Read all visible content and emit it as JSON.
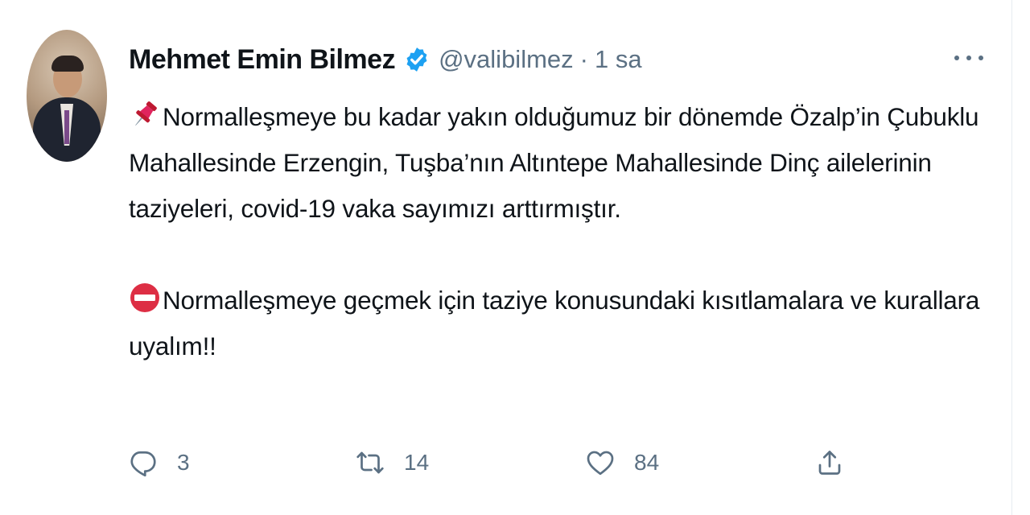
{
  "tweet": {
    "author_name": "Mehmet Emin Bilmez",
    "handle": "@valibilmez",
    "separator": "·",
    "time": "1 sa",
    "paragraphs": [
      {
        "emoji": "pushpin-emoji",
        "text": "Normalleşmeye bu kadar yakın olduğumuz bir dönemde Özalp’in Çubuklu Mahallesinde Erzengin, Tuşba’nın Altıntepe Mahallesinde Dinç ailelerinin taziyeleri, covid-19 vaka sayımızı arttırmıştır."
      },
      {
        "emoji": "no-entry-emoji",
        "text": "Normalleşmeye geçmek için taziye konusundaki kısıtlamalara ve kurallara uyalım!!"
      }
    ],
    "actions": {
      "reply_count": "3",
      "retweet_count": "14",
      "like_count": "84"
    }
  },
  "colors": {
    "verified": "#1da1f2",
    "secondary_text": "#5b7083",
    "pushpin": "#e0245e",
    "no_entry": "#dd2e44"
  }
}
